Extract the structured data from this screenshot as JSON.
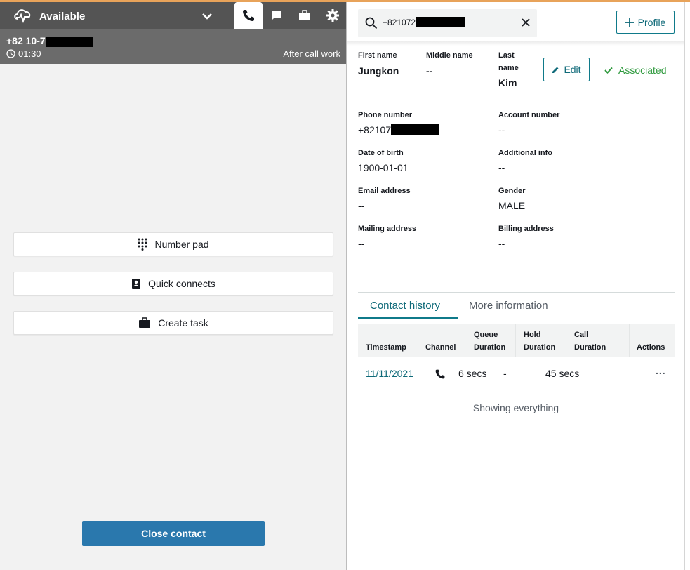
{
  "ccp": {
    "status": "Available",
    "contact": {
      "number_prefix": "+82 10-7",
      "timer": "01:30",
      "state": "After call work"
    },
    "buttons": {
      "number_pad": "Number pad",
      "quick_connects": "Quick connects",
      "create_task": "Create task",
      "close_contact": "Close contact"
    },
    "icons": [
      "status-cloud-icon",
      "chevron-down-icon",
      "phone-icon",
      "chat-icon",
      "briefcase-icon",
      "gear-icon",
      "clock-icon",
      "keypad-icon",
      "contacts-book-icon",
      "briefcase-icon"
    ]
  },
  "search": {
    "value_prefix": "+821072"
  },
  "profile_button": "Profile",
  "customer": {
    "labels": {
      "first_name": "First name",
      "middle_name": "Middle name",
      "last_name_1": "Last",
      "last_name_2": "name",
      "phone": "Phone number",
      "account": "Account number",
      "dob": "Date of birth",
      "additional": "Additional info",
      "email": "Email address",
      "gender": "Gender",
      "mailing": "Mailing address",
      "billing": "Billing address"
    },
    "values": {
      "first_name": "Jungkon",
      "middle_name": "--",
      "last_name": "Kim",
      "phone_prefix": "+82107",
      "account": "--",
      "dob": "1900-01-01",
      "additional": "--",
      "email": "--",
      "gender": "MALE",
      "mailing": "--",
      "billing": "--"
    },
    "edit_label": "Edit",
    "association": "Associated"
  },
  "tabs": {
    "contact_history": "Contact history",
    "more_information": "More information"
  },
  "history": {
    "headers": {
      "timestamp": "Timestamp",
      "channel": "Channel",
      "queue_1": "Queue",
      "queue_2": "Duration",
      "hold_1": "Hold",
      "hold_2": "Duration",
      "call_1": "Call",
      "call_2": "Duration",
      "actions": "Actions"
    },
    "rows": [
      {
        "timestamp": "11/11/2021",
        "channel": "phone",
        "queue": "6 secs",
        "hold": "-",
        "call": "45 secs",
        "actions": "..."
      }
    ],
    "footer": "Showing everything"
  },
  "colors": {
    "accent": "#0f7a8a",
    "primary_button": "#2a78ad",
    "associated": "#2f9a3e",
    "header_bg": "#545454"
  }
}
